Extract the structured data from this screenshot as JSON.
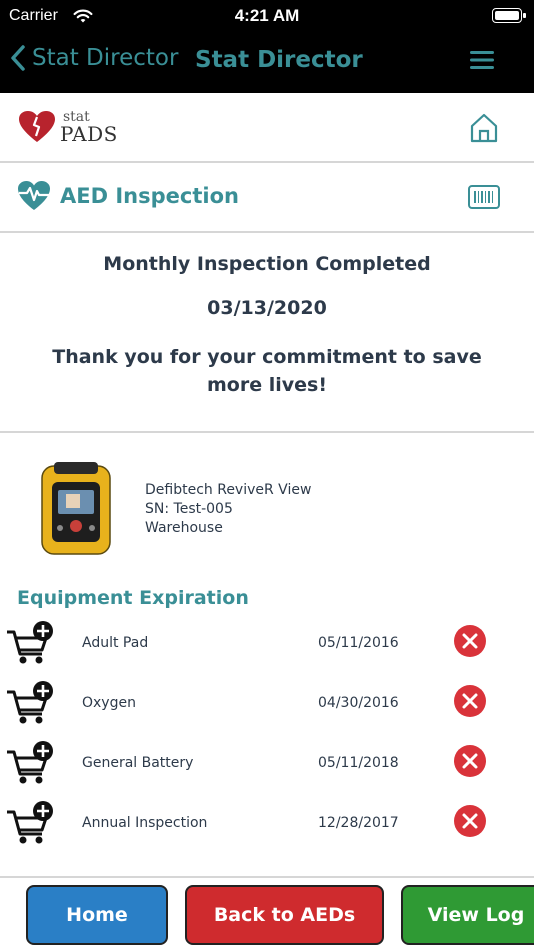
{
  "status_bar": {
    "carrier": "Carrier",
    "time": "4:21 AM"
  },
  "nav": {
    "back_label": "Stat Director",
    "title": "Stat Director"
  },
  "logo": {
    "top": "stat",
    "bottom": "PADS"
  },
  "section": {
    "title": "AED Inspection"
  },
  "inspection": {
    "heading": "Monthly Inspection Completed",
    "date": "03/13/2020",
    "message": "Thank you for your commitment to save more lives!"
  },
  "device": {
    "model": "Defibtech ReviveR View",
    "serial": "SN: Test-005",
    "location": "Warehouse"
  },
  "equipment": {
    "title": "Equipment Expiration",
    "items": [
      {
        "name": "Adult Pad",
        "date": "05/11/2016",
        "status": "expired"
      },
      {
        "name": "Oxygen",
        "date": "04/30/2016",
        "status": "expired"
      },
      {
        "name": "General Battery",
        "date": "05/11/2018",
        "status": "expired"
      },
      {
        "name": "Annual Inspection",
        "date": "12/28/2017",
        "status": "expired"
      }
    ]
  },
  "buttons": {
    "home": "Home",
    "back": "Back to AEDs",
    "log": "View Log"
  },
  "colors": {
    "accent": "#3a8f96",
    "home_btn": "#2a7fc6",
    "back_btn": "#cf2b2e",
    "log_btn": "#2f9a34",
    "expired": "#d9333a"
  }
}
